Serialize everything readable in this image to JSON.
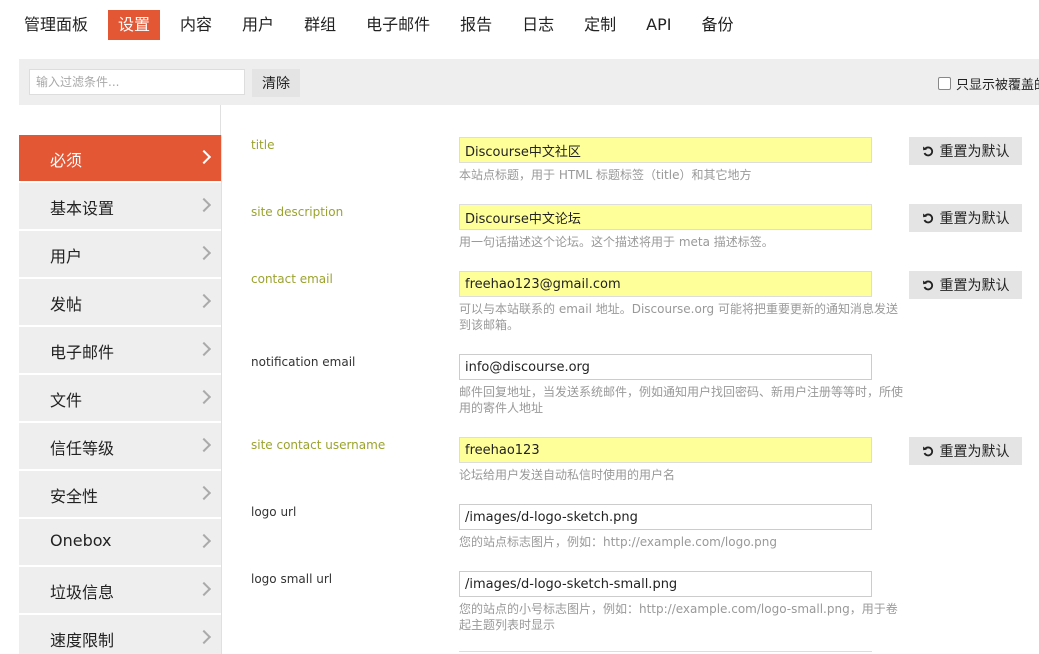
{
  "nav": {
    "tabs": [
      {
        "label": "管理面板",
        "active": false
      },
      {
        "label": "设置",
        "active": true
      },
      {
        "label": "内容",
        "active": false
      },
      {
        "label": "用户",
        "active": false
      },
      {
        "label": "群组",
        "active": false
      },
      {
        "label": "电子邮件",
        "active": false
      },
      {
        "label": "报告",
        "active": false
      },
      {
        "label": "日志",
        "active": false
      },
      {
        "label": "定制",
        "active": false
      },
      {
        "label": "API",
        "active": false
      },
      {
        "label": "备份",
        "active": false
      }
    ]
  },
  "filter": {
    "placeholder": "输入过滤条件...",
    "clear_label": "清除",
    "only_overridden_label": "只显示被覆盖的"
  },
  "sidebar": {
    "items": [
      {
        "label": "必须",
        "active": true
      },
      {
        "label": "基本设置",
        "active": false
      },
      {
        "label": "用户",
        "active": false
      },
      {
        "label": "发帖",
        "active": false
      },
      {
        "label": "电子邮件",
        "active": false
      },
      {
        "label": "文件",
        "active": false
      },
      {
        "label": "信任等级",
        "active": false
      },
      {
        "label": "安全性",
        "active": false
      },
      {
        "label": "Onebox",
        "active": false
      },
      {
        "label": "垃圾信息",
        "active": false
      },
      {
        "label": "速度限制",
        "active": false
      }
    ]
  },
  "settings": [
    {
      "name": "title",
      "value": "Discourse中文社区",
      "description": "本站点标题，用于 HTML 标题标签（title）和其它地方",
      "overridden": true,
      "reset_label": "重置为默认"
    },
    {
      "name": "site description",
      "value": "Discourse中文论坛",
      "description": "用一句话描述这个论坛。这个描述将用于 meta 描述标签。",
      "overridden": true,
      "reset_label": "重置为默认"
    },
    {
      "name": "contact email",
      "value": "freehao123@gmail.com",
      "description": "可以与本站联系的 email 地址。Discourse.org 可能将把重要更新的通知消息发送到该邮箱。",
      "overridden": true,
      "reset_label": "重置为默认"
    },
    {
      "name": "notification email",
      "value": "info@discourse.org",
      "description": "邮件回复地址，当发送系统邮件，例如通知用户找回密码、新用户注册等等时，所使用的寄件人地址",
      "overridden": false
    },
    {
      "name": "site contact username",
      "value": "freehao123",
      "description": "论坛给用户发送自动私信时使用的用户名",
      "overridden": true,
      "reset_label": "重置为默认"
    },
    {
      "name": "logo url",
      "value": "/images/d-logo-sketch.png",
      "description": "您的站点标志图片，例如：http://example.com/logo.png",
      "overridden": false
    },
    {
      "name": "logo small url",
      "value": "/images/d-logo-sketch-small.png",
      "description": "您的站点的小号标志图片，例如：http://example.com/logo-small.png，用于卷起主题列表时显示",
      "overridden": false
    }
  ],
  "colors": {
    "accent": "#e45735",
    "override_highlight": "#ffff99",
    "override_label": "#9aa32e"
  },
  "icons": {
    "reset": "undo-icon",
    "sidebar_chevron": "chevron-right-icon",
    "filter_checkbox": "checkbox-icon"
  }
}
